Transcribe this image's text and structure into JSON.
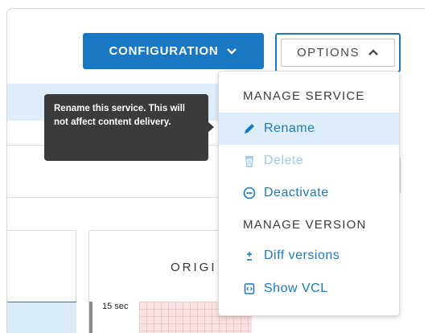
{
  "toolbar": {
    "configuration_label": "CONFIGURATION",
    "options_label": "OPTIONS"
  },
  "tooltip": {
    "text": "Rename this service. This will not affect content delivery."
  },
  "menu": {
    "section1": "MANAGE SERVICE",
    "rename": "Rename",
    "delete": "Delete",
    "deactivate": "Deactivate",
    "section2": "MANAGE VERSION",
    "diff": "Diff versions",
    "show_vcl": "Show VCL"
  },
  "dashboard": {
    "origin_title": "ORIGI",
    "axis_label": "15 sec"
  },
  "colors": {
    "accent": "#1a78c2",
    "tooltip_bg": "#3b3b3b",
    "highlight": "#ddeef9"
  }
}
